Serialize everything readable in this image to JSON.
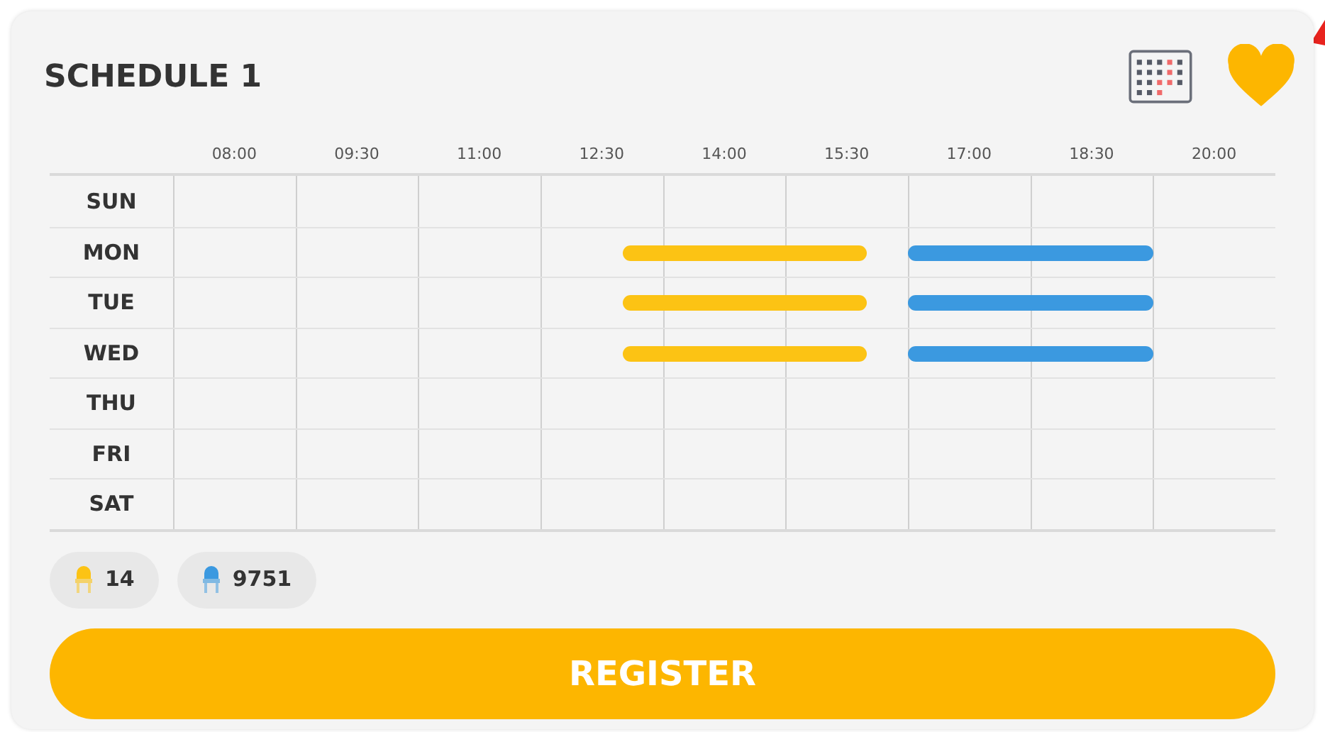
{
  "title": "SCHEDULE 1",
  "favorite": true,
  "times": [
    "08:00",
    "09:30",
    "11:00",
    "12:30",
    "14:00",
    "15:30",
    "17:00",
    "18:30",
    "20:00"
  ],
  "days": [
    {
      "label": "SUN"
    },
    {
      "label": "MON",
      "bars": [
        {
          "kind": "afternoon",
          "color": "#fcc314"
        },
        {
          "kind": "evening",
          "color": "#3b99e0"
        }
      ]
    },
    {
      "label": "TUE",
      "bars": [
        {
          "kind": "afternoon",
          "color": "#fcc314"
        },
        {
          "kind": "evening",
          "color": "#3b99e0"
        }
      ]
    },
    {
      "label": "WED",
      "bars": [
        {
          "kind": "afternoon",
          "color": "#fcc314"
        },
        {
          "kind": "evening",
          "color": "#3b99e0"
        }
      ]
    },
    {
      "label": "THU"
    },
    {
      "label": "FRI"
    },
    {
      "label": "SAT"
    }
  ],
  "seats": [
    {
      "count": "14",
      "color": "#fcc314"
    },
    {
      "count": "9751",
      "color": "#3b99e0"
    }
  ],
  "button": "REGISTER"
}
